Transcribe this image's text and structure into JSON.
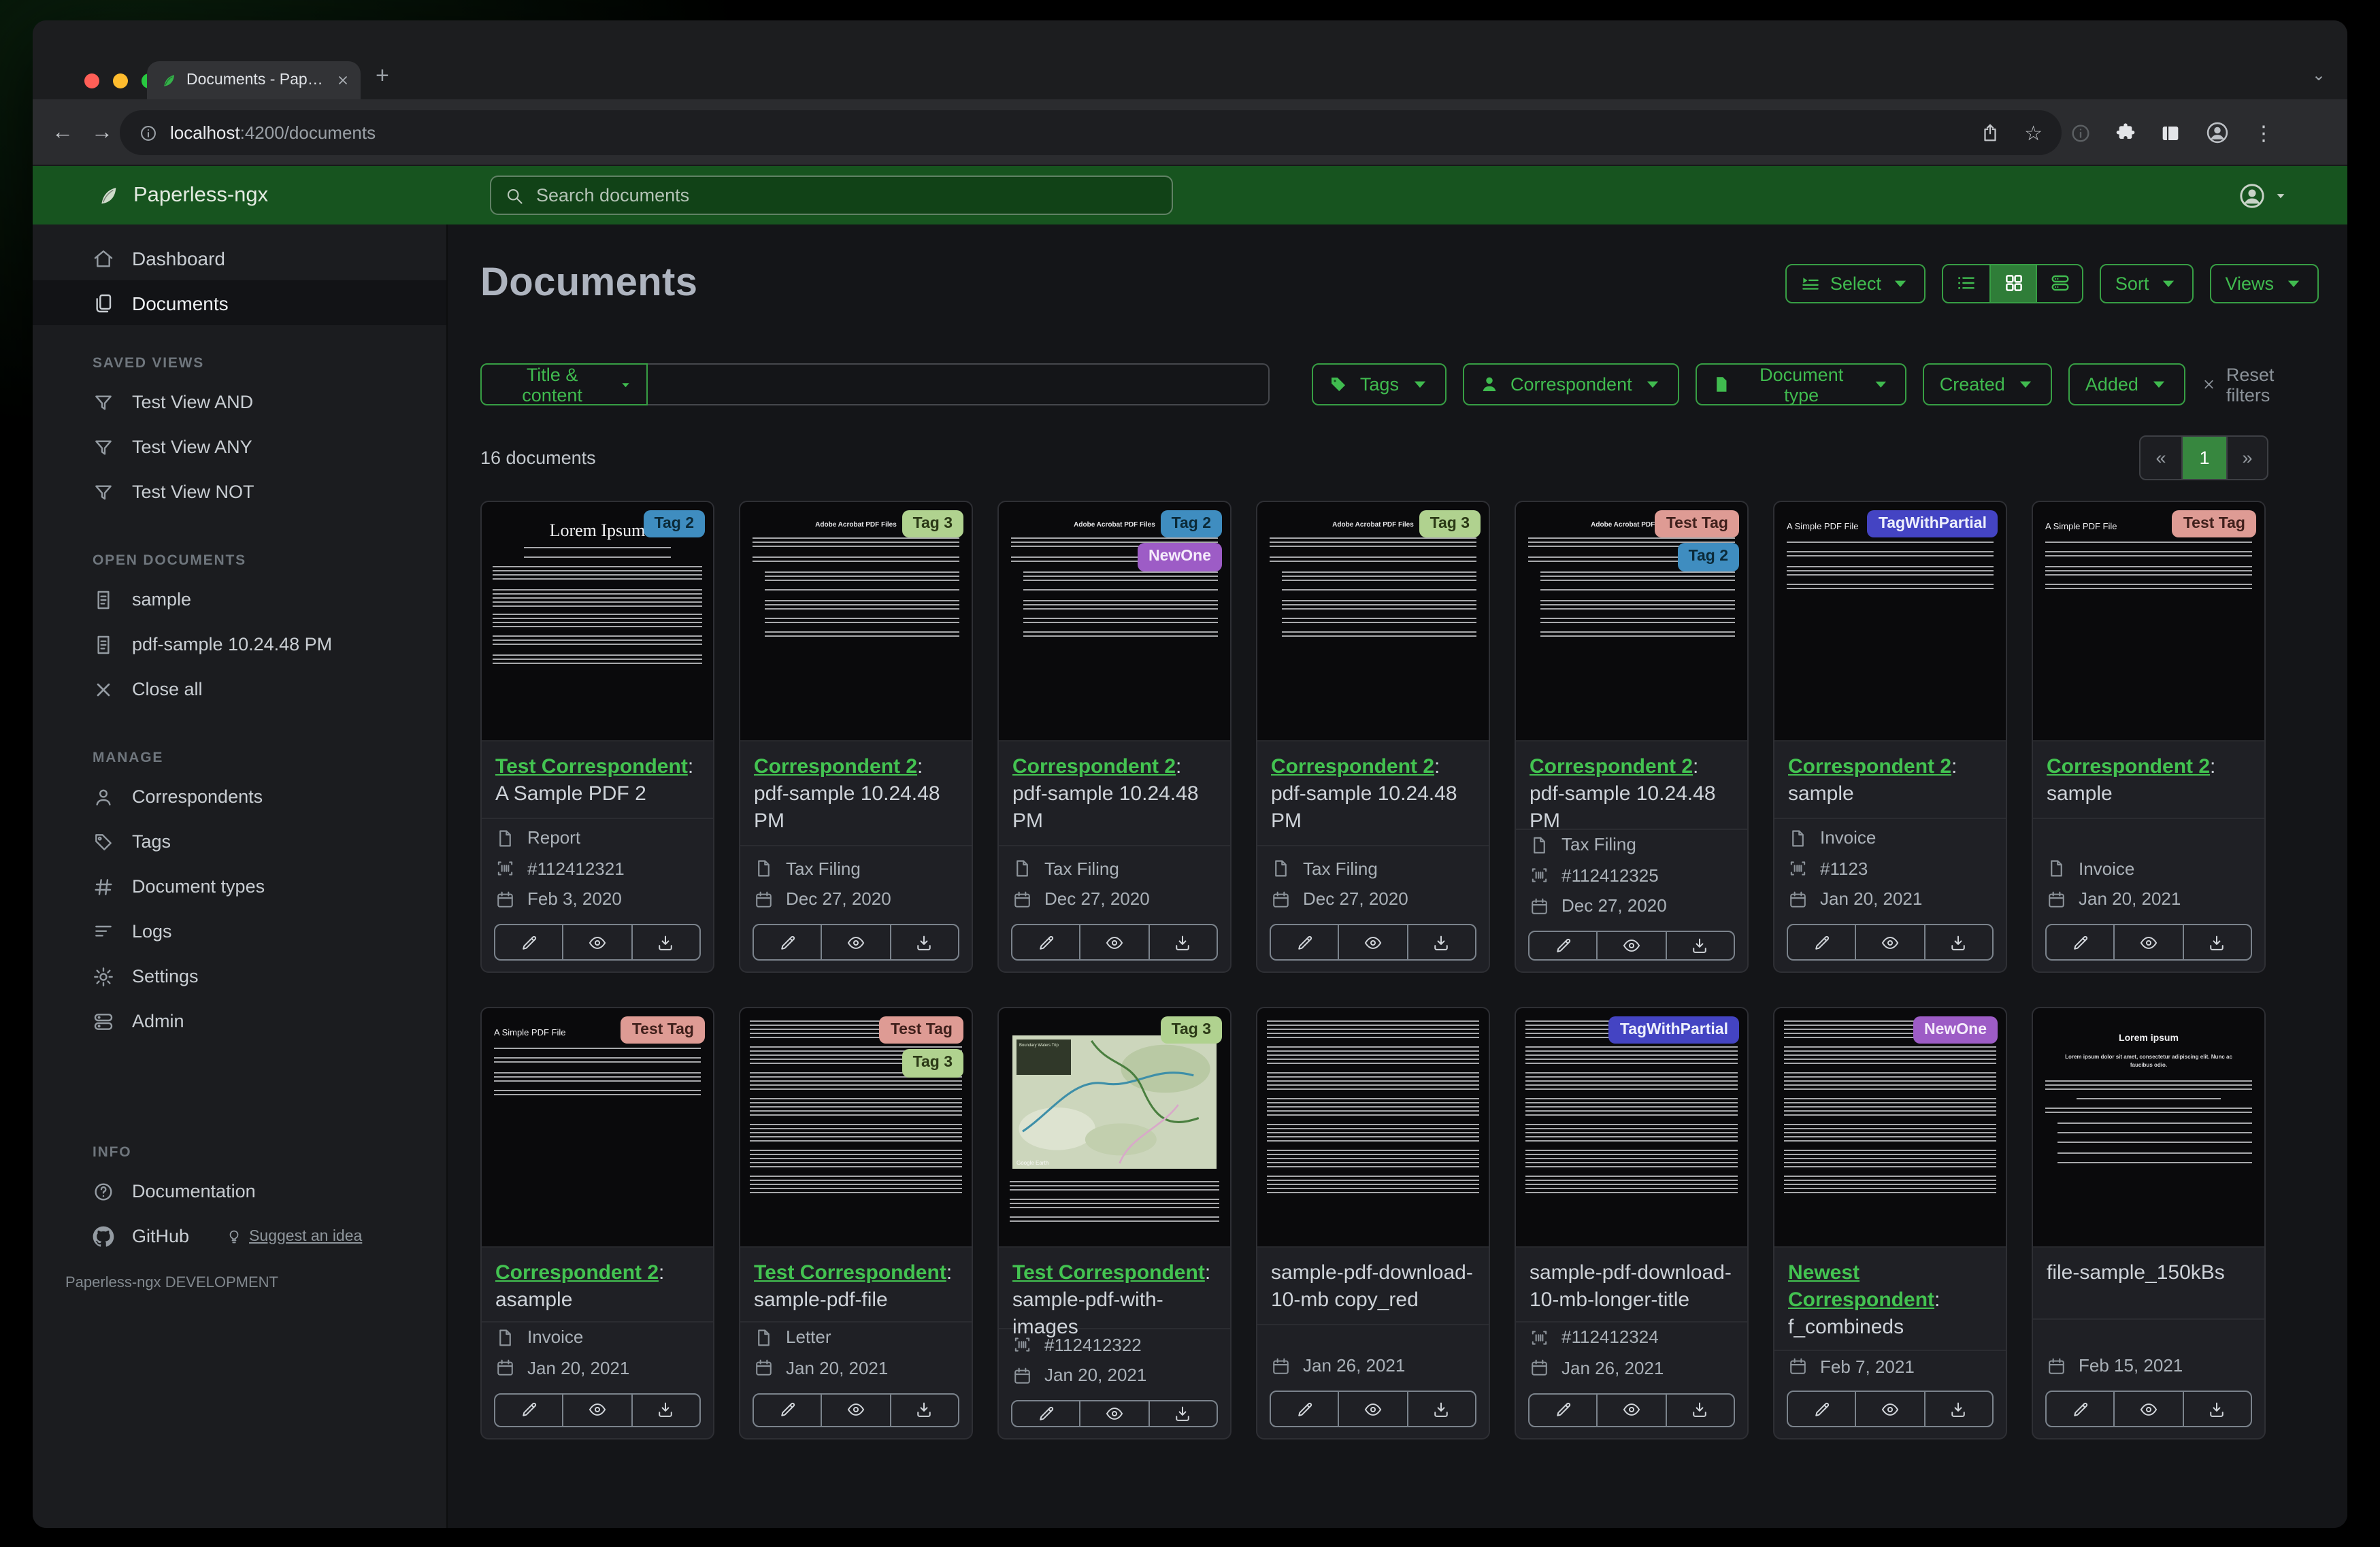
{
  "colors": {
    "brand_green": "#17541f",
    "accent_green": "#40bb4f",
    "active_view_bg": "#2f7d38"
  },
  "glyphs": {
    "back": "←",
    "forward": "→",
    "reload": "↻",
    "new_tab": "+",
    "kebab": "⋮",
    "star": "☆",
    "tab_chevron": "⌄"
  },
  "browser": {
    "tab_title": "Documents - Paperless-ngx",
    "url_host": "localhost",
    "url_suffix": ":4200/documents"
  },
  "appbar": {
    "brand": "Paperless-ngx",
    "search_placeholder": "Search documents"
  },
  "sidebar": {
    "primary": [
      {
        "label": "Dashboard",
        "icon": "home"
      },
      {
        "label": "Documents",
        "icon": "docs",
        "active": true
      }
    ],
    "sections": [
      {
        "heading": "SAVED VIEWS",
        "items": [
          {
            "label": "Test View AND",
            "icon": "funnel"
          },
          {
            "label": "Test View ANY",
            "icon": "funnel"
          },
          {
            "label": "Test View NOT",
            "icon": "funnel"
          }
        ]
      },
      {
        "heading": "OPEN DOCUMENTS",
        "items": [
          {
            "label": "sample",
            "icon": "doc"
          },
          {
            "label": "pdf-sample 10.24.48 PM",
            "icon": "doc"
          },
          {
            "label": "Close all",
            "icon": "close"
          }
        ]
      },
      {
        "heading": "MANAGE",
        "items": [
          {
            "label": "Correspondents",
            "icon": "person"
          },
          {
            "label": "Tags",
            "icon": "tag"
          },
          {
            "label": "Document types",
            "icon": "hash"
          },
          {
            "label": "Logs",
            "icon": "lines"
          },
          {
            "label": "Settings",
            "icon": "gear"
          },
          {
            "label": "Admin",
            "icon": "sliders"
          }
        ]
      },
      {
        "heading": "INFO",
        "items": [
          {
            "label": "Documentation",
            "icon": "qcircle"
          },
          {
            "label": "GitHub",
            "icon": "github",
            "extra": "Suggest an idea"
          }
        ]
      }
    ],
    "footer": "Paperless-ngx DEVELOPMENT"
  },
  "page": {
    "title": "Documents",
    "select": "Select",
    "sort": "Sort",
    "views": "Views",
    "count": "16 documents",
    "reset": "Reset filters",
    "pagination": {
      "prev": "«",
      "current": "1",
      "next": "»"
    }
  },
  "filters": {
    "field": "Title & content",
    "tags": "Tags",
    "correspondent": "Correspondent",
    "doc_type": "Document type",
    "created": "Created",
    "added": "Added"
  },
  "tag_defs": {
    "Tag 2": {
      "bg": "#3f8dc0",
      "fg": "#0b2a38"
    },
    "Tag 3": {
      "bg": "#b0d28f",
      "fg": "#2c3a17"
    },
    "Test Tag": {
      "bg": "#de9b94",
      "fg": "#40201c"
    },
    "NewOne": {
      "bg": "#9d5cc6",
      "fg": "#f5ecfb"
    },
    "TagWithPartial": {
      "bg": "#4444c3",
      "fg": "#edeffc"
    }
  },
  "cards": [
    {
      "tags": [
        "Tag 2"
      ],
      "thumb": {
        "kind": "serif",
        "heading": "Lorem Ipsum"
      },
      "correspondent": "Test Correspondent",
      "title": "A Sample PDF 2",
      "doc_type": "Report",
      "asn": "#112412321",
      "date": "Feb 3, 2020"
    },
    {
      "tags": [
        "Tag 3"
      ],
      "thumb": {
        "kind": "adobe",
        "heading": "Adobe Acrobat PDF Files"
      },
      "correspondent": "Correspondent 2",
      "title": "pdf-sample 10.24.48 PM",
      "doc_type": "Tax Filing",
      "date": "Dec 27, 2020"
    },
    {
      "tags": [
        "Tag 2",
        "NewOne"
      ],
      "thumb": {
        "kind": "adobe",
        "heading": "Adobe Acrobat PDF Files"
      },
      "correspondent": "Correspondent 2",
      "title": "pdf-sample 10.24.48 PM",
      "doc_type": "Tax Filing",
      "date": "Dec 27, 2020"
    },
    {
      "tags": [
        "Tag 3"
      ],
      "thumb": {
        "kind": "adobe",
        "heading": "Adobe Acrobat PDF Files"
      },
      "correspondent": "Correspondent 2",
      "title": "pdf-sample 10.24.48 PM",
      "doc_type": "Tax Filing",
      "date": "Dec 27, 2020"
    },
    {
      "tags": [
        "Test Tag",
        "Tag 2"
      ],
      "thumb": {
        "kind": "adobe",
        "heading": "Adobe Acrobat PDF Files"
      },
      "correspondent": "Correspondent 2",
      "title": "pdf-sample 10.24.48 PM",
      "doc_type": "Tax Filing",
      "asn": "#112412325",
      "date": "Dec 27, 2020"
    },
    {
      "tags": [
        "TagWithPartial"
      ],
      "thumb": {
        "kind": "simple",
        "heading": "A Simple PDF File"
      },
      "correspondent": "Correspondent 2",
      "title": "sample",
      "doc_type": "Invoice",
      "asn": "#1123",
      "date": "Jan 20, 2021"
    },
    {
      "tags": [
        "Test Tag"
      ],
      "thumb": {
        "kind": "simple",
        "heading": "A Simple PDF File"
      },
      "correspondent": "Correspondent 2",
      "title": "sample",
      "doc_type": "Invoice",
      "date": "Jan 20, 2021"
    },
    {
      "tags": [
        "Test Tag"
      ],
      "thumb": {
        "kind": "simple",
        "heading": "A Simple PDF File"
      },
      "correspondent": "Correspondent 2",
      "title": "asample",
      "doc_type": "Invoice",
      "date": "Jan 20, 2021"
    },
    {
      "tags": [
        "Test Tag",
        "Tag 3"
      ],
      "thumb": {
        "kind": "dense"
      },
      "correspondent": "Test Correspondent",
      "title": "sample-pdf-file",
      "doc_type": "Letter",
      "date": "Jan 20, 2021"
    },
    {
      "tags": [
        "Tag 3"
      ],
      "thumb": {
        "kind": "map",
        "legend": "Boundary Waters Trip",
        "credit": "Google Earth"
      },
      "correspondent": "Test Correspondent",
      "title": "sample-pdf-with-images",
      "asn": "#112412322",
      "date": "Jan 20, 2021"
    },
    {
      "tags": [],
      "thumb": {
        "kind": "dense"
      },
      "title": "sample-pdf-download-10-mb copy_red",
      "date": "Jan 26, 2021"
    },
    {
      "tags": [
        "TagWithPartial"
      ],
      "thumb": {
        "kind": "dense"
      },
      "title": "sample-pdf-download-10-mb-longer-title",
      "asn": "#112412324",
      "date": "Jan 26, 2021"
    },
    {
      "tags": [
        "NewOne"
      ],
      "thumb": {
        "kind": "dense"
      },
      "correspondent": "Newest Correspondent",
      "title": "f_combineds",
      "date": "Feb 7, 2021"
    },
    {
      "tags": [],
      "thumb": {
        "kind": "loremhead",
        "heading": "Lorem ipsum",
        "sub": "Lorem ipsum dolor sit amet, consectetur adipiscing elit. Nunc ac faucibus odio."
      },
      "title": "file-sample_150kBs",
      "date": "Feb 15, 2021"
    }
  ]
}
